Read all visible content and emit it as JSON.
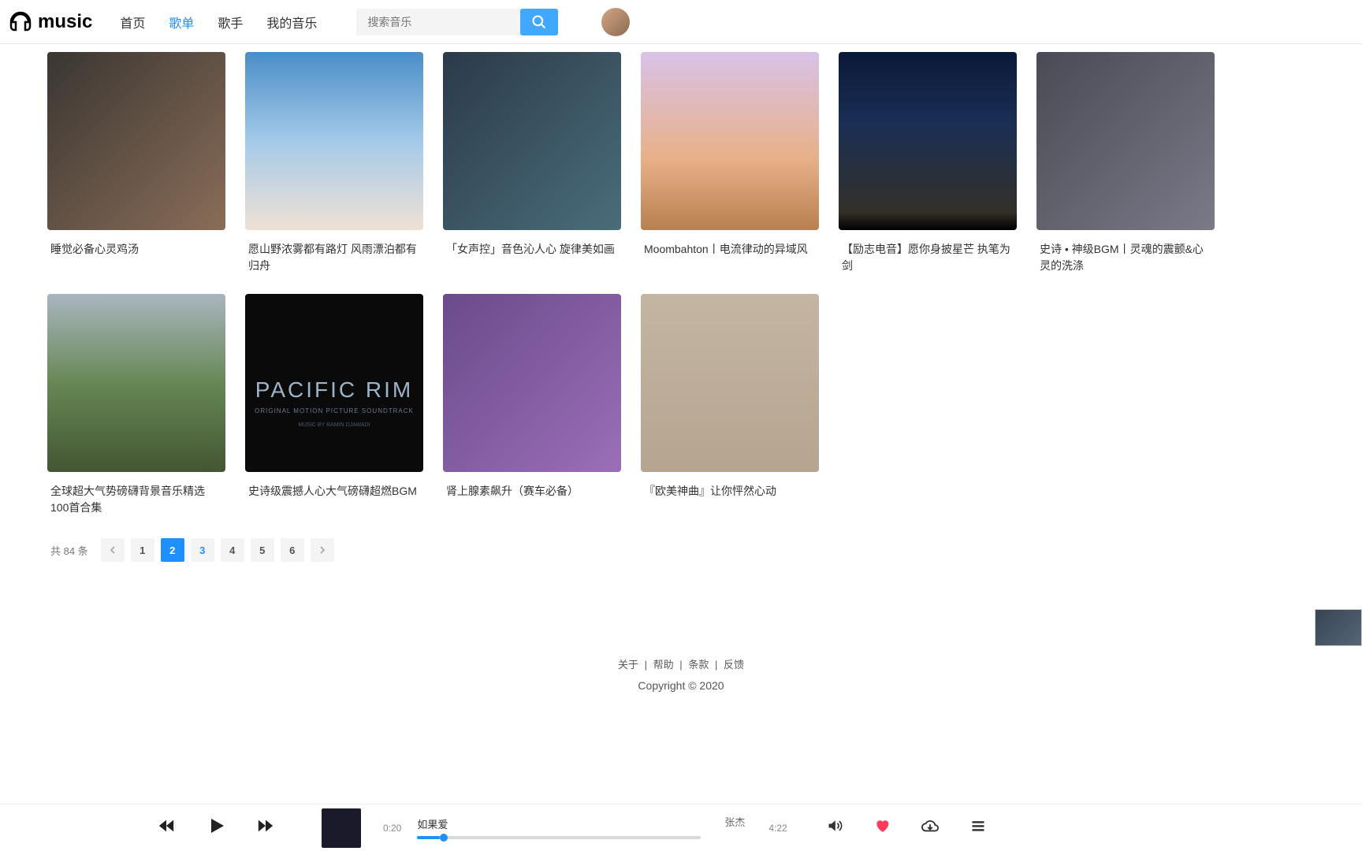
{
  "header": {
    "logo_text": "music",
    "nav": [
      "首页",
      "歌单",
      "歌手",
      "我的音乐"
    ],
    "active_index": 1,
    "search_placeholder": "搜索音乐"
  },
  "playlists": {
    "row1": [
      {
        "title": "睡觉必备心灵鸡汤"
      },
      {
        "title": "愿山野浓雾都有路灯 风雨漂泊都有归舟"
      },
      {
        "title": "「女声控」音色沁人心 旋律美如画"
      },
      {
        "title": "Moombahton丨电流律动的异域风"
      },
      {
        "title": "【励志电音】愿你身披星芒 执笔为剑"
      }
    ],
    "row2": [
      {
        "title": "史诗 • 神级BGM丨灵魂的震颤&心灵的洗涤"
      },
      {
        "title": "全球超大气势磅礴背景音乐精选100首合集"
      },
      {
        "title": "史诗级震撼人心大气磅礴超燃BGM",
        "overlay": {
          "line1": "PACIFIC RIM",
          "line2": "ORIGINAL MOTION PICTURE SOUNDTRACK",
          "line3": "MUSIC BY RAMIN DJAWADI"
        }
      },
      {
        "title": "肾上腺素飙升（赛车必备）"
      },
      {
        "title": "『欧美神曲』让你怦然心动"
      }
    ]
  },
  "pagination": {
    "total_text": "共 84 条",
    "pages": [
      "1",
      "2",
      "3",
      "4",
      "5",
      "6"
    ],
    "current": 1,
    "hover": 2
  },
  "footer": {
    "links": [
      "关于",
      "帮助",
      "条款",
      "反馈"
    ],
    "sep": "|",
    "copyright": "Copyright © 2020"
  },
  "player": {
    "current_time": "0:20",
    "total_time": "4:22",
    "song": "如果爱",
    "artist": "张杰",
    "progress_percent": 8
  }
}
